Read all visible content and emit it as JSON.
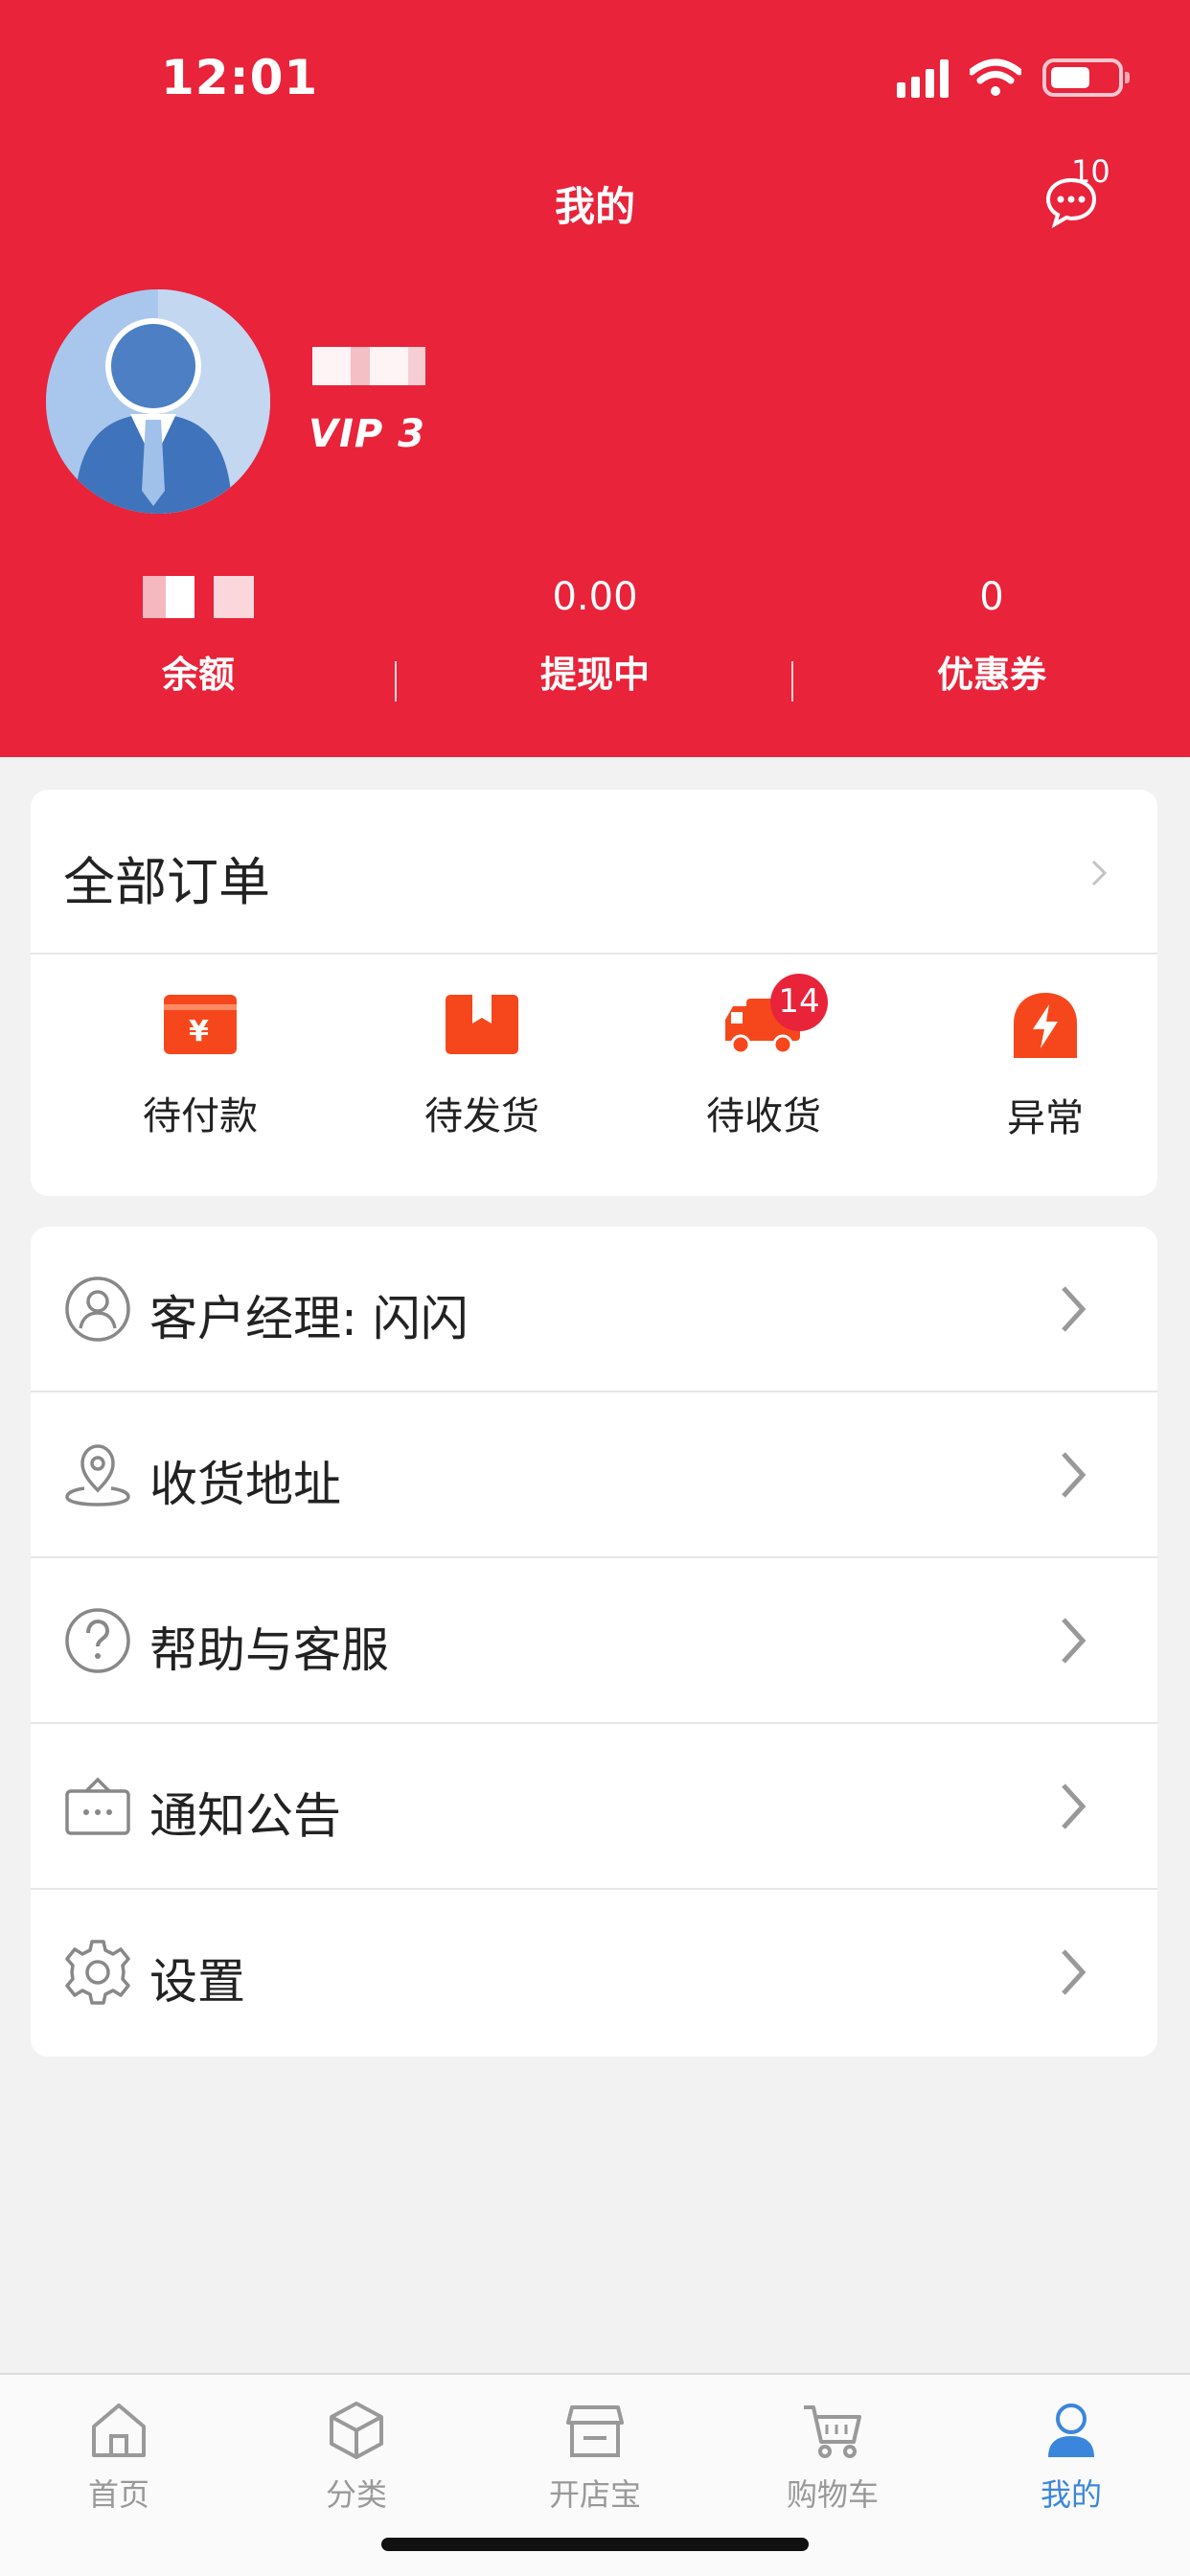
{
  "status_bar": {
    "time": "12:01"
  },
  "header": {
    "title": "我的",
    "message_count": "10",
    "vip_level": "VIP 3",
    "stats": [
      {
        "value": "",
        "label": "余额"
      },
      {
        "value": "0.00",
        "label": "提现中"
      },
      {
        "value": "0",
        "label": "优惠券"
      }
    ]
  },
  "orders": {
    "title": "全部订单",
    "items": [
      {
        "label": "待付款",
        "icon": "wallet-yuan-icon"
      },
      {
        "label": "待发货",
        "icon": "box-icon"
      },
      {
        "label": "待收货",
        "icon": "truck-icon",
        "badge": "14"
      },
      {
        "label": "异常",
        "icon": "lightning-icon"
      }
    ]
  },
  "menu": {
    "items": [
      {
        "label": "客户经理: 闪闪",
        "icon": "person-circle-icon"
      },
      {
        "label": "收货地址",
        "icon": "location-pin-icon"
      },
      {
        "label": "帮助与客服",
        "icon": "question-circle-icon"
      },
      {
        "label": "通知公告",
        "icon": "notice-board-icon"
      },
      {
        "label": "设置",
        "icon": "gear-icon"
      }
    ]
  },
  "tabbar": {
    "items": [
      {
        "label": "首页",
        "icon": "home-icon"
      },
      {
        "label": "分类",
        "icon": "cube-icon"
      },
      {
        "label": "开店宝",
        "icon": "shop-icon"
      },
      {
        "label": "购物车",
        "icon": "cart-icon"
      },
      {
        "label": "我的",
        "icon": "user-icon",
        "active": true
      }
    ]
  },
  "colors": {
    "brand_red": "#e8233a",
    "accent_orange": "#f6471c",
    "tab_active": "#3a86dc"
  }
}
